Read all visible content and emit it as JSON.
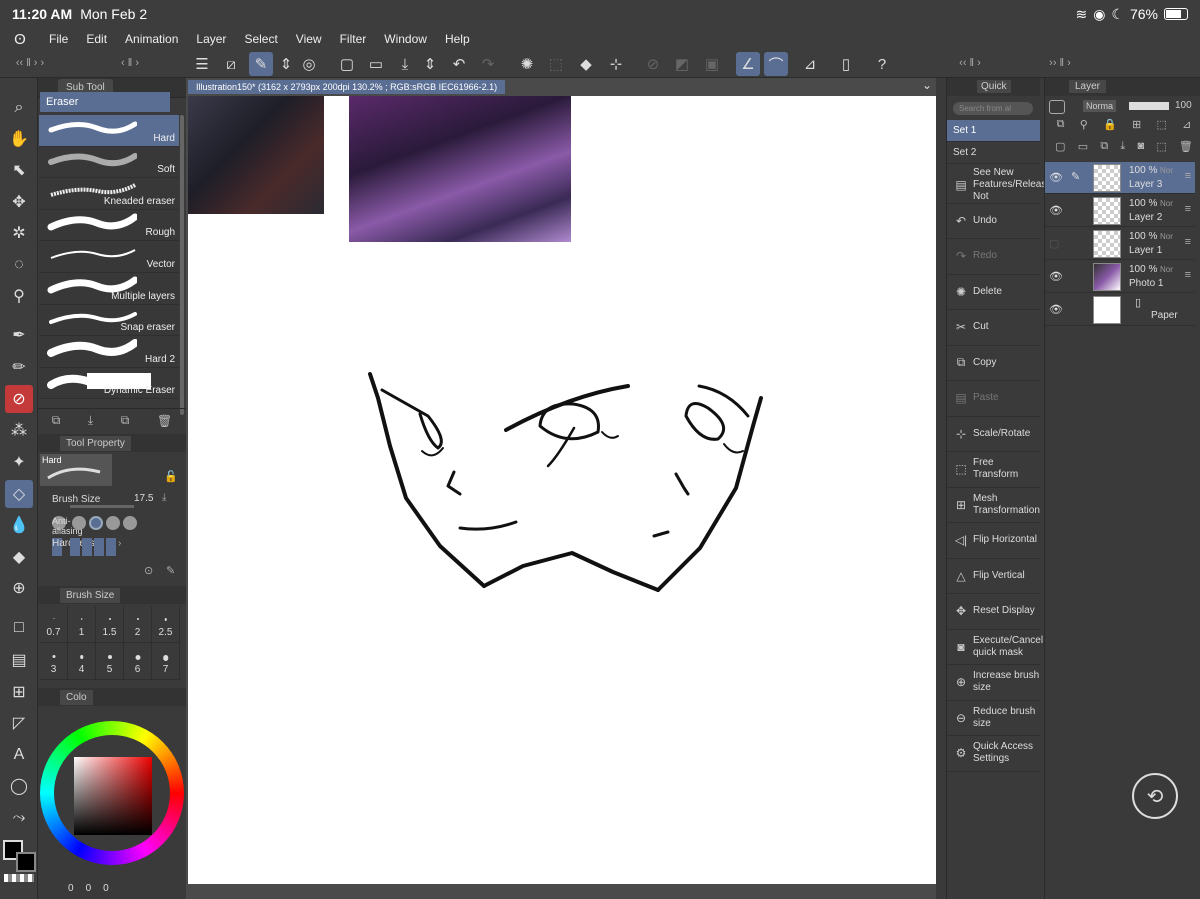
{
  "status": {
    "time": "11:20 AM",
    "date": "Mon Feb 2",
    "battery": "76%"
  },
  "menu": [
    "File",
    "Edit",
    "Animation",
    "Layer",
    "Select",
    "View",
    "Filter",
    "Window",
    "Help"
  ],
  "subtool": {
    "panel_title": "Sub Tool",
    "group": "Eraser",
    "brushes": [
      "Hard",
      "Soft",
      "Kneaded eraser",
      "Rough",
      "Vector",
      "Multiple layers",
      "Snap eraser",
      "Hard 2",
      "Dynamic Eraser"
    ]
  },
  "tool_property": {
    "panel_title": "Tool Property",
    "preset": "Hard",
    "brush_size_label": "Brush Size",
    "brush_size_value": "17.5",
    "antialias_label": "Anti-aliasing",
    "hardness_label": "Hardness"
  },
  "brush_size_panel": {
    "title": "Brush Size",
    "sizes": [
      "0.7",
      "1",
      "1.5",
      "2",
      "2.5",
      "3",
      "4",
      "5",
      "6",
      "7"
    ]
  },
  "color_panel": {
    "tab": "Colo",
    "r": "0",
    "g": "0",
    "b": "0",
    "main_color": "#000000",
    "sub_color": "#ffffff"
  },
  "document": {
    "tab": "Illustration150* (3162 x 2793px 200dpi 130.2% ; RGB:sRGB IEC61966-2.1)"
  },
  "quick_access": {
    "title": "Quick",
    "search_placeholder": "Search from al",
    "sets": [
      "Set 1",
      "Set 2"
    ],
    "items": [
      {
        "label": "See New Features/Release Not",
        "icon": "new-icon",
        "enabled": true
      },
      {
        "label": "Undo",
        "icon": "undo-icon",
        "enabled": true
      },
      {
        "label": "Redo",
        "icon": "redo-icon",
        "enabled": false
      },
      {
        "label": "Delete",
        "icon": "delete-icon",
        "enabled": true
      },
      {
        "label": "Cut",
        "icon": "cut-icon",
        "enabled": true
      },
      {
        "label": "Copy",
        "icon": "copy-icon",
        "enabled": true
      },
      {
        "label": "Paste",
        "icon": "paste-icon",
        "enabled": false
      },
      {
        "label": "Scale/Rotate",
        "icon": "scale-icon",
        "enabled": true
      },
      {
        "label": "Free Transform",
        "icon": "free-transform-icon",
        "enabled": true
      },
      {
        "label": "Mesh Transformation",
        "icon": "mesh-icon",
        "enabled": true
      },
      {
        "label": "Flip Horizontal",
        "icon": "flip-horizontal-icon",
        "enabled": true
      },
      {
        "label": "Flip Vertical",
        "icon": "flip-vertical-icon",
        "enabled": true
      },
      {
        "label": "Reset Display",
        "icon": "reset-display-icon",
        "enabled": true
      },
      {
        "label": "Execute/Cancel quick mask",
        "icon": "quick-mask-icon",
        "enabled": true
      },
      {
        "label": "Increase brush size",
        "icon": "increase-brush-icon",
        "enabled": true
      },
      {
        "label": "Reduce brush size",
        "icon": "reduce-brush-icon",
        "enabled": true
      },
      {
        "label": "Quick Access Settings",
        "icon": "settings-icon",
        "enabled": true
      }
    ]
  },
  "layer_panel": {
    "title": "Layer",
    "blend_mode": "Norma",
    "opacity": "100",
    "layers": [
      {
        "opacity": "100 %",
        "blend": "Nor",
        "name": "Layer 3",
        "visible": true
      },
      {
        "opacity": "100 %",
        "blend": "Nor",
        "name": "Layer 2",
        "visible": true
      },
      {
        "opacity": "100 %",
        "blend": "Nor",
        "name": "Layer 1",
        "visible": false
      },
      {
        "opacity": "100 %",
        "blend": "Nor",
        "name": "Photo 1",
        "visible": true
      },
      {
        "opacity": "",
        "blend": "",
        "name": "Paper",
        "visible": true
      }
    ]
  },
  "colors": {
    "accent": "#5a6e94",
    "panel": "#3a3a3a",
    "eraser_active": "#c43a3a"
  }
}
